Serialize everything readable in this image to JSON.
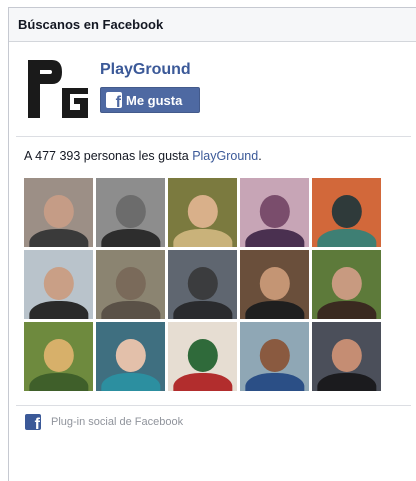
{
  "widget": {
    "title": "Búscanos en Facebook"
  },
  "page": {
    "name": "PlayGround",
    "logo_text": "PG",
    "like_button_label": "Me gusta"
  },
  "likes": {
    "prefix": "A 477 393 personas les gusta ",
    "page_link": "PlayGround",
    "suffix": "."
  },
  "faces": [
    {
      "bg": "#9c8f86",
      "skin": "#c59c86",
      "shirt": "#3a3a3a"
    },
    {
      "bg": "#8d8d8d",
      "skin": "#6c6c6c",
      "shirt": "#2d2d2d"
    },
    {
      "bg": "#7b7a3f",
      "skin": "#d9b08a",
      "shirt": "#c9b27a"
    },
    {
      "bg": "#c7a5b6",
      "skin": "#7a4d6c",
      "shirt": "#4a3050"
    },
    {
      "bg": "#d2683a",
      "skin": "#2f3a3a",
      "shirt": "#3e7f74"
    },
    {
      "bg": "#b9c3cb",
      "skin": "#c99f86",
      "shirt": "#2a2a2a"
    },
    {
      "bg": "#8b8471",
      "skin": "#7a6a5a",
      "shirt": "#5a5147"
    },
    {
      "bg": "#5f6670",
      "skin": "#3b3c3e",
      "shirt": "#2a2b2e"
    },
    {
      "bg": "#6a4f3b",
      "skin": "#c49574",
      "shirt": "#1f1f1f"
    },
    {
      "bg": "#5d7a3a",
      "skin": "#c89a80",
      "shirt": "#3a2a20"
    },
    {
      "bg": "#6e8a3e",
      "skin": "#d7b06a",
      "shirt": "#3f5f2a"
    },
    {
      "bg": "#3f6f80",
      "skin": "#e3c0aa",
      "shirt": "#2c8fa0"
    },
    {
      "bg": "#e6ddd2",
      "skin": "#2f6a3a",
      "shirt": "#b22d2d"
    },
    {
      "bg": "#8fa7b5",
      "skin": "#8a5a40",
      "shirt": "#2b4f86"
    },
    {
      "bg": "#4b4f5a",
      "skin": "#c58d73",
      "shirt": "#1b1b1e"
    }
  ],
  "footer": {
    "label": "Plug-in social de Facebook"
  }
}
